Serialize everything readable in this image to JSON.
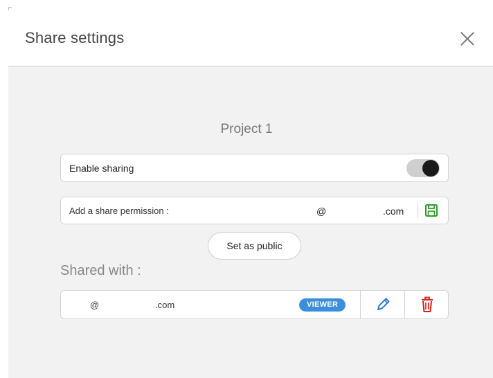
{
  "dialog": {
    "title": "Share settings",
    "project_name": "Project 1"
  },
  "sharing": {
    "label": "Enable sharing",
    "enabled": true
  },
  "permission": {
    "label": "Add a share permission :",
    "at": "@",
    "domain": ".com"
  },
  "public_button": "Set as public",
  "shared_with": {
    "heading": "Shared with :",
    "users": [
      {
        "at": "@",
        "domain": ".com",
        "role": "VIEWER"
      }
    ]
  },
  "colors": {
    "save_icon": "#2a9d2a",
    "viewer_badge": "#3a8fdc",
    "edit_icon": "#2a78d0",
    "delete_icon": "#d42020"
  }
}
